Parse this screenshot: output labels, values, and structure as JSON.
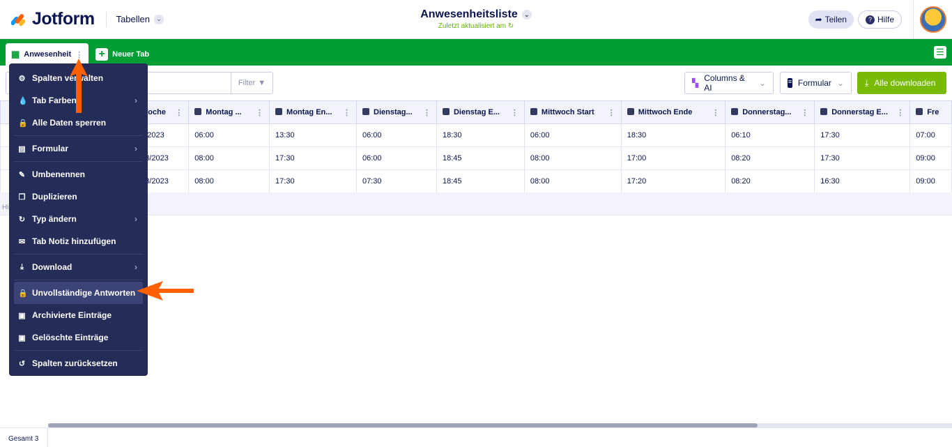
{
  "header": {
    "brand": "Jotform",
    "product": "Tabellen",
    "title": "Anwesenheitsliste",
    "subtitle": "Zuletzt aktualisiert am",
    "share": "Teilen",
    "help": "Hilfe"
  },
  "tabs": {
    "active": "Anwesenheit",
    "new": "Neuer Tab"
  },
  "toolbar": {
    "filter": "Filter",
    "columns_ai": "Columns & AI",
    "form": "Formular",
    "download_all": "Alle downloaden"
  },
  "table": {
    "headers": [
      "Woche",
      "Montag ...",
      "Montag En...",
      "Dienstag...",
      "Dienstag E...",
      "Mittwoch Start",
      "Mittwoch Ende",
      "Donnerstag...",
      "Donnerstag E...",
      "Fre"
    ],
    "rows": [
      [
        "2/2023",
        "06:00",
        "13:30",
        "06:00",
        "18:30",
        "06:00",
        "18:30",
        "06:10",
        "17:30",
        "07:00"
      ],
      [
        "03/2023",
        "08:00",
        "17:30",
        "06:00",
        "18:45",
        "08:00",
        "17:00",
        "08:20",
        "17:30",
        "09:00"
      ],
      [
        "03/2023",
        "08:00",
        "17:30",
        "07:30",
        "18:45",
        "08:00",
        "17:20",
        "08:20",
        "16:30",
        "09:00"
      ]
    ],
    "add_row": "Hi"
  },
  "menu": [
    "Spalten verwalten",
    "Tab Farben",
    "Alle Daten sperren",
    "Formular",
    "Umbenennen",
    "Duplizieren",
    "Typ ändern",
    "Tab Notiz hinzufügen",
    "Download",
    "Unvollständige Antworten",
    "Archivierte Einträge",
    "Gelöschte Einträge",
    "Spalten zurücksetzen"
  ],
  "footer": {
    "total": "Gesamt 3"
  },
  "colors": {
    "green": "#029e35",
    "navy": "#252c58",
    "accent": "#78bb07",
    "arrow": "#ff6100"
  }
}
